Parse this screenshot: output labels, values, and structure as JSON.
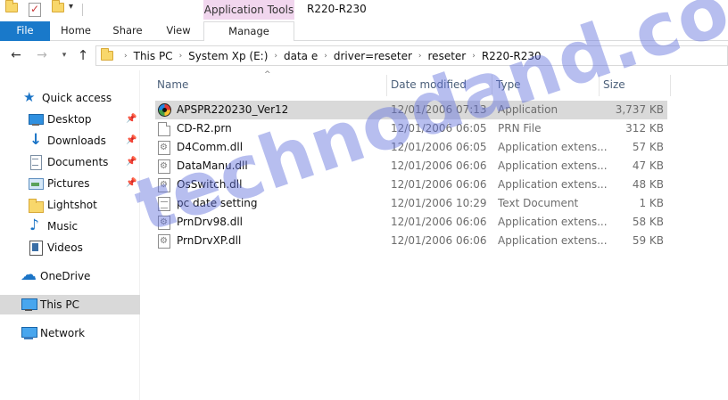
{
  "window": {
    "title": "R220-R230",
    "context_tab_group": "Application Tools"
  },
  "ribbon": {
    "tabs": [
      {
        "label": "File",
        "active": true
      },
      {
        "label": "Home"
      },
      {
        "label": "Share"
      },
      {
        "label": "View"
      },
      {
        "label": "Manage"
      }
    ]
  },
  "address": {
    "crumbs": [
      "This PC",
      "System Xp (E:)",
      "data e",
      "driver=reseter",
      "reseter",
      "R220-R230"
    ]
  },
  "sidebar": {
    "items": [
      {
        "label": "Quick access",
        "icon": "star-icon"
      },
      {
        "label": "Desktop",
        "icon": "desktop-icon",
        "pinned": true
      },
      {
        "label": "Downloads",
        "icon": "downloads-icon",
        "pinned": true
      },
      {
        "label": "Documents",
        "icon": "documents-icon",
        "pinned": true
      },
      {
        "label": "Pictures",
        "icon": "pictures-icon",
        "pinned": true
      },
      {
        "label": "Lightshot",
        "icon": "folder-icon"
      },
      {
        "label": "Music",
        "icon": "music-icon"
      },
      {
        "label": "Videos",
        "icon": "videos-icon"
      },
      {
        "label": "OneDrive",
        "icon": "onedrive-icon"
      },
      {
        "label": "This PC",
        "icon": "this-pc-icon",
        "selected": true
      },
      {
        "label": "Network",
        "icon": "network-icon"
      }
    ]
  },
  "file_list": {
    "columns": {
      "name": "Name",
      "date": "Date modified",
      "type": "Type",
      "size": "Size"
    },
    "rows": [
      {
        "name": "APSPR220230_Ver12",
        "date": "12/01/2006 07:13",
        "type": "Application",
        "size": "3,737 KB",
        "icon": "application-icon",
        "selected": true
      },
      {
        "name": "CD-R2.prn",
        "date": "12/01/2006 06:05",
        "type": "PRN File",
        "size": "312 KB",
        "icon": "file-icon"
      },
      {
        "name": "D4Comm.dll",
        "date": "12/01/2006 06:05",
        "type": "Application extens...",
        "size": "57 KB",
        "icon": "dll-icon"
      },
      {
        "name": "DataManu.dll",
        "date": "12/01/2006 06:06",
        "type": "Application extens...",
        "size": "47 KB",
        "icon": "dll-icon"
      },
      {
        "name": "OsSwitch.dll",
        "date": "12/01/2006 06:06",
        "type": "Application extens...",
        "size": "48 KB",
        "icon": "dll-icon"
      },
      {
        "name": "pc date setting",
        "date": "12/01/2006 10:29",
        "type": "Text Document",
        "size": "1 KB",
        "icon": "text-file-icon"
      },
      {
        "name": "PrnDrv98.dll",
        "date": "12/01/2006 06:06",
        "type": "Application extens...",
        "size": "58 KB",
        "icon": "dll-icon"
      },
      {
        "name": "PrnDrvXP.dll",
        "date": "12/01/2006 06:06",
        "type": "Application extens...",
        "size": "59 KB",
        "icon": "dll-icon"
      }
    ]
  },
  "watermark": {
    "text": "technodand.com"
  },
  "colors": {
    "accent": "#1979ca",
    "context_tab": "#f1d6ee",
    "selection": "#d9d9d9",
    "header_text": "#4c607a",
    "watermark": "#5f6edc"
  }
}
